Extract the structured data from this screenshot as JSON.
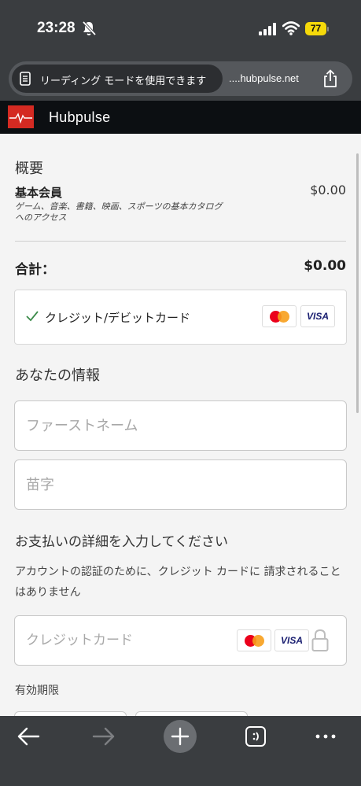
{
  "status_bar": {
    "time": "23:28",
    "battery": "77"
  },
  "address_bar": {
    "reader_mode_label": "リーディング モードを使用できます",
    "url": "....hubpulse.net"
  },
  "site": {
    "name": "Hubpulse"
  },
  "summary": {
    "heading": "概要",
    "plan_name": "基本会員",
    "plan_price": "$0.00",
    "plan_description": "ゲーム、音楽、書籍、映画、スポーツの基本カタログへのアクセス",
    "total_label": "合計：",
    "total_price": "$0.00"
  },
  "payment_method": {
    "label": "クレジット/デビットカード",
    "visa_text": "VISA"
  },
  "your_info": {
    "heading": "あなたの情報",
    "first_name_placeholder": "ファーストネーム",
    "last_name_placeholder": "苗字"
  },
  "payment_details": {
    "heading": "お支払いの詳細を入力してください",
    "notice": "アカウントの認証のために、クレジット カードに 請求されることはありません",
    "card_placeholder": "クレジットカード",
    "visa_text": "VISA",
    "expiry_label": "有効期限"
  },
  "colors": {
    "brand": "#d42a22",
    "header_bg": "#0c0f12",
    "check": "#3c8b4a",
    "visa": "#1a1f71"
  }
}
